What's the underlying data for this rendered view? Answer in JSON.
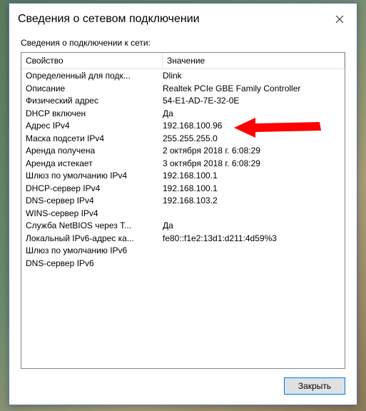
{
  "window": {
    "title": "Сведения о сетевом подключении",
    "subtitle": "Сведения о подключении к сети:"
  },
  "columns": {
    "property": "Свойство",
    "value": "Значение"
  },
  "rows": [
    {
      "prop": "Определенный для подк...",
      "val": "Dlink"
    },
    {
      "prop": "Описание",
      "val": "Realtek PCIe GBE Family Controller"
    },
    {
      "prop": "Физический адрес",
      "val": "54-E1-AD-7E-32-0E"
    },
    {
      "prop": "DHCP включен",
      "val": "Да"
    },
    {
      "prop": "Адрес IPv4",
      "val": "192.168.100.96"
    },
    {
      "prop": "Маска подсети IPv4",
      "val": "255.255.255.0"
    },
    {
      "prop": "Аренда получена",
      "val": "2 октября 2018 г. 6:08:29"
    },
    {
      "prop": "Аренда истекает",
      "val": "3 октября 2018 г. 6:08:29"
    },
    {
      "prop": "Шлюз по умолчанию IPv4",
      "val": "192.168.100.1"
    },
    {
      "prop": "DHCP-сервер IPv4",
      "val": "192.168.100.1"
    },
    {
      "prop": "DNS-сервер IPv4",
      "val": "192.168.103.2"
    },
    {
      "prop": "WINS-сервер IPv4",
      "val": ""
    },
    {
      "prop": "Служба NetBIOS через T...",
      "val": "Да"
    },
    {
      "prop": "Локальный IPv6-адрес ка...",
      "val": "fe80::f1e2:13d1:d211:4d59%3"
    },
    {
      "prop": "Шлюз по умолчанию IPv6",
      "val": ""
    },
    {
      "prop": "DNS-сервер IPv6",
      "val": ""
    }
  ],
  "buttons": {
    "close": "Закрыть"
  },
  "annotation": {
    "arrow_color": "#ff0000",
    "highlight_row_index": 4
  }
}
